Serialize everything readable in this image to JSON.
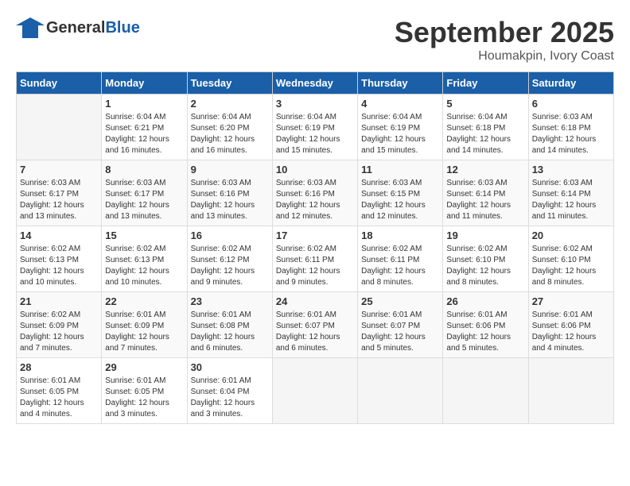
{
  "header": {
    "logo_general": "General",
    "logo_blue": "Blue",
    "month": "September 2025",
    "location": "Houmakpin, Ivory Coast"
  },
  "days_of_week": [
    "Sunday",
    "Monday",
    "Tuesday",
    "Wednesday",
    "Thursday",
    "Friday",
    "Saturday"
  ],
  "weeks": [
    [
      {
        "day": "",
        "info": ""
      },
      {
        "day": "1",
        "info": "Sunrise: 6:04 AM\nSunset: 6:21 PM\nDaylight: 12 hours\nand 16 minutes."
      },
      {
        "day": "2",
        "info": "Sunrise: 6:04 AM\nSunset: 6:20 PM\nDaylight: 12 hours\nand 16 minutes."
      },
      {
        "day": "3",
        "info": "Sunrise: 6:04 AM\nSunset: 6:19 PM\nDaylight: 12 hours\nand 15 minutes."
      },
      {
        "day": "4",
        "info": "Sunrise: 6:04 AM\nSunset: 6:19 PM\nDaylight: 12 hours\nand 15 minutes."
      },
      {
        "day": "5",
        "info": "Sunrise: 6:04 AM\nSunset: 6:18 PM\nDaylight: 12 hours\nand 14 minutes."
      },
      {
        "day": "6",
        "info": "Sunrise: 6:03 AM\nSunset: 6:18 PM\nDaylight: 12 hours\nand 14 minutes."
      }
    ],
    [
      {
        "day": "7",
        "info": "Sunrise: 6:03 AM\nSunset: 6:17 PM\nDaylight: 12 hours\nand 13 minutes."
      },
      {
        "day": "8",
        "info": "Sunrise: 6:03 AM\nSunset: 6:17 PM\nDaylight: 12 hours\nand 13 minutes."
      },
      {
        "day": "9",
        "info": "Sunrise: 6:03 AM\nSunset: 6:16 PM\nDaylight: 12 hours\nand 13 minutes."
      },
      {
        "day": "10",
        "info": "Sunrise: 6:03 AM\nSunset: 6:16 PM\nDaylight: 12 hours\nand 12 minutes."
      },
      {
        "day": "11",
        "info": "Sunrise: 6:03 AM\nSunset: 6:15 PM\nDaylight: 12 hours\nand 12 minutes."
      },
      {
        "day": "12",
        "info": "Sunrise: 6:03 AM\nSunset: 6:14 PM\nDaylight: 12 hours\nand 11 minutes."
      },
      {
        "day": "13",
        "info": "Sunrise: 6:03 AM\nSunset: 6:14 PM\nDaylight: 12 hours\nand 11 minutes."
      }
    ],
    [
      {
        "day": "14",
        "info": "Sunrise: 6:02 AM\nSunset: 6:13 PM\nDaylight: 12 hours\nand 10 minutes."
      },
      {
        "day": "15",
        "info": "Sunrise: 6:02 AM\nSunset: 6:13 PM\nDaylight: 12 hours\nand 10 minutes."
      },
      {
        "day": "16",
        "info": "Sunrise: 6:02 AM\nSunset: 6:12 PM\nDaylight: 12 hours\nand 9 minutes."
      },
      {
        "day": "17",
        "info": "Sunrise: 6:02 AM\nSunset: 6:11 PM\nDaylight: 12 hours\nand 9 minutes."
      },
      {
        "day": "18",
        "info": "Sunrise: 6:02 AM\nSunset: 6:11 PM\nDaylight: 12 hours\nand 8 minutes."
      },
      {
        "day": "19",
        "info": "Sunrise: 6:02 AM\nSunset: 6:10 PM\nDaylight: 12 hours\nand 8 minutes."
      },
      {
        "day": "20",
        "info": "Sunrise: 6:02 AM\nSunset: 6:10 PM\nDaylight: 12 hours\nand 8 minutes."
      }
    ],
    [
      {
        "day": "21",
        "info": "Sunrise: 6:02 AM\nSunset: 6:09 PM\nDaylight: 12 hours\nand 7 minutes."
      },
      {
        "day": "22",
        "info": "Sunrise: 6:01 AM\nSunset: 6:09 PM\nDaylight: 12 hours\nand 7 minutes."
      },
      {
        "day": "23",
        "info": "Sunrise: 6:01 AM\nSunset: 6:08 PM\nDaylight: 12 hours\nand 6 minutes."
      },
      {
        "day": "24",
        "info": "Sunrise: 6:01 AM\nSunset: 6:07 PM\nDaylight: 12 hours\nand 6 minutes."
      },
      {
        "day": "25",
        "info": "Sunrise: 6:01 AM\nSunset: 6:07 PM\nDaylight: 12 hours\nand 5 minutes."
      },
      {
        "day": "26",
        "info": "Sunrise: 6:01 AM\nSunset: 6:06 PM\nDaylight: 12 hours\nand 5 minutes."
      },
      {
        "day": "27",
        "info": "Sunrise: 6:01 AM\nSunset: 6:06 PM\nDaylight: 12 hours\nand 4 minutes."
      }
    ],
    [
      {
        "day": "28",
        "info": "Sunrise: 6:01 AM\nSunset: 6:05 PM\nDaylight: 12 hours\nand 4 minutes."
      },
      {
        "day": "29",
        "info": "Sunrise: 6:01 AM\nSunset: 6:05 PM\nDaylight: 12 hours\nand 3 minutes."
      },
      {
        "day": "30",
        "info": "Sunrise: 6:01 AM\nSunset: 6:04 PM\nDaylight: 12 hours\nand 3 minutes."
      },
      {
        "day": "",
        "info": ""
      },
      {
        "day": "",
        "info": ""
      },
      {
        "day": "",
        "info": ""
      },
      {
        "day": "",
        "info": ""
      }
    ]
  ]
}
